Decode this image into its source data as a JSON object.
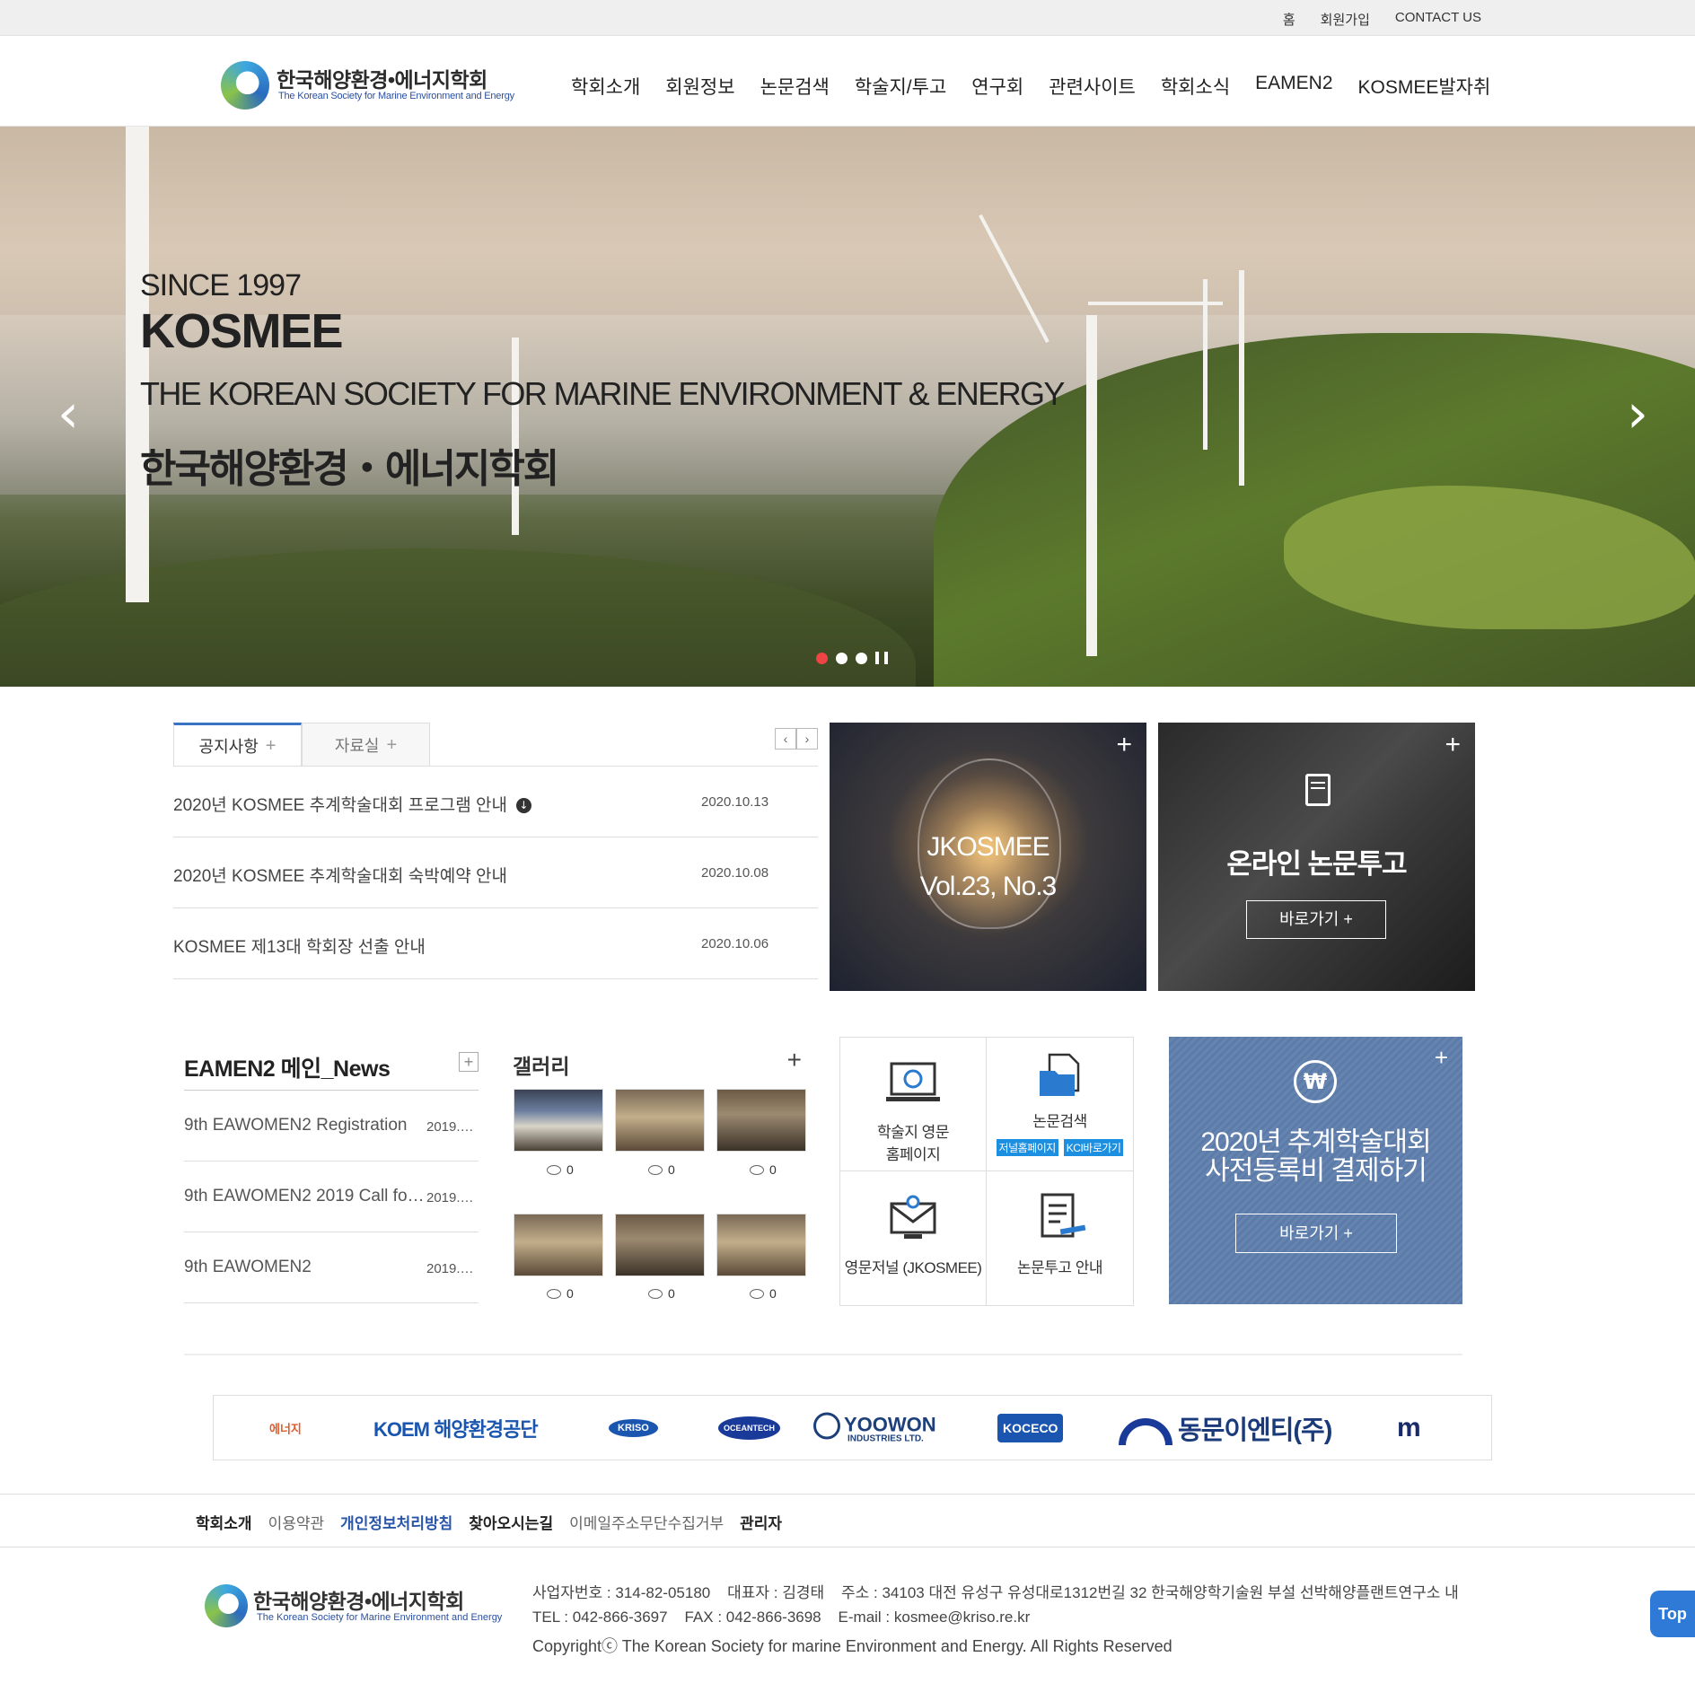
{
  "topbar": {
    "links": [
      "홈",
      "회원가입",
      "CONTACT US"
    ]
  },
  "header": {
    "logo_kr": "한국해양환경•에너지학회",
    "logo_en": "The Korean Society for Marine Environment and Energy",
    "nav": [
      "학회소개",
      "회원정보",
      "논문검색",
      "학술지/투고",
      "연구회",
      "관련사이트",
      "학회소식",
      "EAMEN2",
      "KOSMEE발자취"
    ]
  },
  "hero": {
    "since": "SINCE 1997",
    "brand": "KOSMEE",
    "full_name": "THE KOREAN SOCIETY FOR MARINE ENVIRONMENT & ENERGY",
    "kor_name": "한국해양환경・에너지학회",
    "prev_icon": "chevron-left-icon",
    "next_icon": "chevron-right-icon"
  },
  "board": {
    "tabs": [
      "공지사항",
      "자료실"
    ],
    "rows": [
      {
        "title": "2020년 KOSMEE 추계학술대회 프로그램 안내",
        "date": "2020.10.13",
        "attachment": true
      },
      {
        "title": "2020년 KOSMEE 추계학술대회 숙박예약 안내",
        "date": "2020.10.08"
      },
      {
        "title": "KOSMEE 제13대 학회장 선출 안내",
        "date": "2020.10.06"
      }
    ]
  },
  "jkosmee": {
    "line1": "JKOSMEE",
    "line2": "Vol.23, No.3"
  },
  "online": {
    "title": "온라인 논문투고",
    "button": "바로가기 +"
  },
  "news": {
    "heading": "EAMEN2 메인_News",
    "rows": [
      {
        "title": "9th EAWOMEN2 Registration",
        "date": "2019.…"
      },
      {
        "title": "9th EAWOMEN2 2019 Call for…",
        "date": "2019.…"
      },
      {
        "title": "9th EAWOMEN2",
        "date": "2019.…"
      }
    ]
  },
  "gallery": {
    "heading": "갤러리",
    "comments": [
      "0",
      "0",
      "0",
      "0",
      "0",
      "0"
    ]
  },
  "quick": {
    "items": [
      {
        "label": "학술지 영문\n홈페이지"
      },
      {
        "label": "논문검색",
        "tags": [
          "저널홈페이지",
          "KCI바로가기"
        ]
      },
      {
        "label": "영문저널 (JKOSMEE)"
      },
      {
        "label": "논문투고 안내"
      }
    ]
  },
  "registration": {
    "line1": "2020년 추계학술대회",
    "line2": "사전등록비 결제하기",
    "button": "바로가기 +",
    "icon": "won-refresh-icon"
  },
  "partners": [
    "에너지",
    "KOEM 해양환경공단",
    "KRISO",
    "OCEANTECH",
    "YOOWON",
    "INDUSTRIES LTD.",
    "KOCECO",
    "동문이엔티(주)",
    "m"
  ],
  "footer_nav": [
    "학회소개",
    "이용약관",
    "개인정보처리방침",
    "찾아오시는길",
    "이메일주소무단수집거부",
    "관리자"
  ],
  "footer": {
    "logo_kr": "한국해양환경•에너지학회",
    "logo_en": "The Korean Society for Marine Environment and Energy",
    "line1": "사업자번호 : 314-82-05180    대표자 : 김경태    주소 : 34103 대전 유성구 유성대로1312번길 32 한국해양학기술원 부설 선박해양플랜트연구소 내",
    "line2": "TEL : 042-866-3697    FAX : 042-866-3698    E-mail : kosmee@kriso.re.kr",
    "copyright": "Copyrightⓒ The Korean Society for marine Environment and Energy. All Rights Reserved"
  },
  "top_button": "Top"
}
